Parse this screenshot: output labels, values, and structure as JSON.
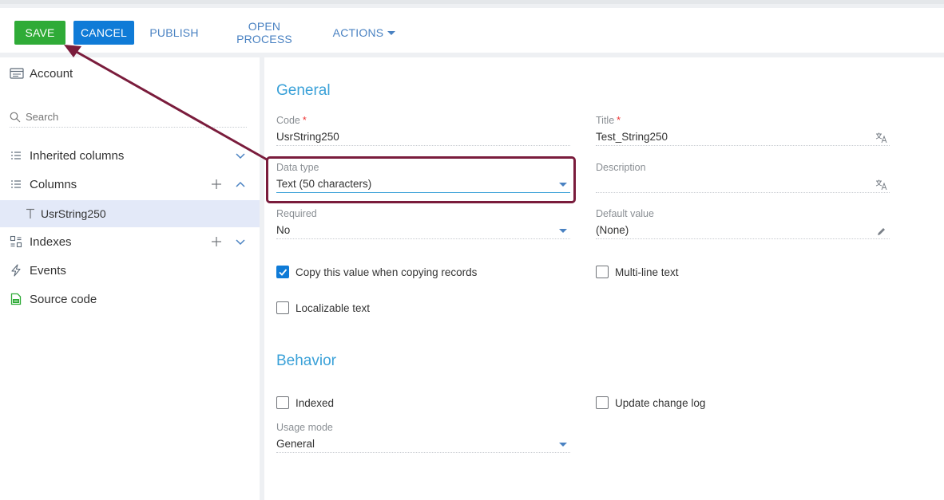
{
  "toolbar": {
    "save": "SAVE",
    "cancel": "CANCEL",
    "publish": "PUBLISH",
    "open_process": "OPEN PROCESS",
    "actions": "ACTIONS"
  },
  "sidebar": {
    "title": "Account",
    "search_placeholder": "Search",
    "items": [
      {
        "label": "Inherited columns"
      },
      {
        "label": "Columns"
      },
      {
        "label": "UsrString250"
      },
      {
        "label": "Indexes"
      },
      {
        "label": "Events"
      },
      {
        "label": "Source code"
      }
    ]
  },
  "main": {
    "general_title": "General",
    "behavior_title": "Behavior",
    "fields": {
      "code": {
        "label": "Code",
        "required_mark": "*",
        "value": "UsrString250"
      },
      "title": {
        "label": "Title",
        "required_mark": "*",
        "value": "Test_String250"
      },
      "data_type": {
        "label": "Data type",
        "value": "Text (50 characters)"
      },
      "description": {
        "label": "Description",
        "value": ""
      },
      "required": {
        "label": "Required",
        "value": "No"
      },
      "default_value": {
        "label": "Default value",
        "value": "(None)"
      },
      "usage_mode": {
        "label": "Usage mode",
        "value": "General"
      }
    },
    "checks": {
      "copy_value": {
        "label": "Copy this value when copying records",
        "checked": true
      },
      "multiline": {
        "label": "Multi-line text",
        "checked": false
      },
      "localizable": {
        "label": "Localizable text",
        "checked": false
      },
      "indexed": {
        "label": "Indexed",
        "checked": false
      },
      "update_log": {
        "label": "Update change log",
        "checked": false
      }
    }
  },
  "colors": {
    "save": "#2fab37",
    "cancel": "#0f7bd7",
    "link": "#4a82c2",
    "section": "#3aa1d8",
    "annotation": "#7a1c3c",
    "selected_row": "#e3e9f8"
  }
}
